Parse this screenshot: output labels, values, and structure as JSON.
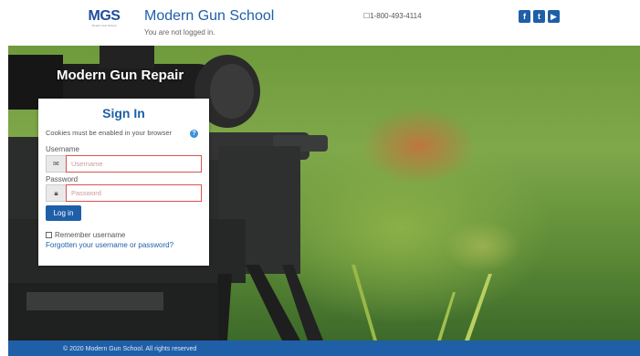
{
  "header": {
    "logo_text": "MGS",
    "logo_sub": "Modern Gun School",
    "site_name": "Modern Gun School",
    "login_status": "You are not logged in.",
    "phone": "1-800-493-4114",
    "social": [
      {
        "icon": "facebook-icon",
        "glyph": "f"
      },
      {
        "icon": "twitter-icon",
        "glyph": "t"
      },
      {
        "icon": "youtube-icon",
        "glyph": "▶"
      }
    ]
  },
  "hero": {
    "title": "Modern Gun Repair"
  },
  "login": {
    "title": "Sign In",
    "cookies_note": "Cookies must be enabled in your browser",
    "username_label": "Username",
    "username_placeholder": "Username",
    "password_label": "Password",
    "password_placeholder": "Password",
    "login_button": "Log in",
    "remember_label": "Remember username",
    "forgot_link": "Forgotten your username or password?"
  },
  "footer": {
    "text": "© 2020 Modern Gun School. All rights reserved"
  },
  "colors": {
    "brand": "#1f5fa8",
    "error_border": "#d9534f"
  }
}
